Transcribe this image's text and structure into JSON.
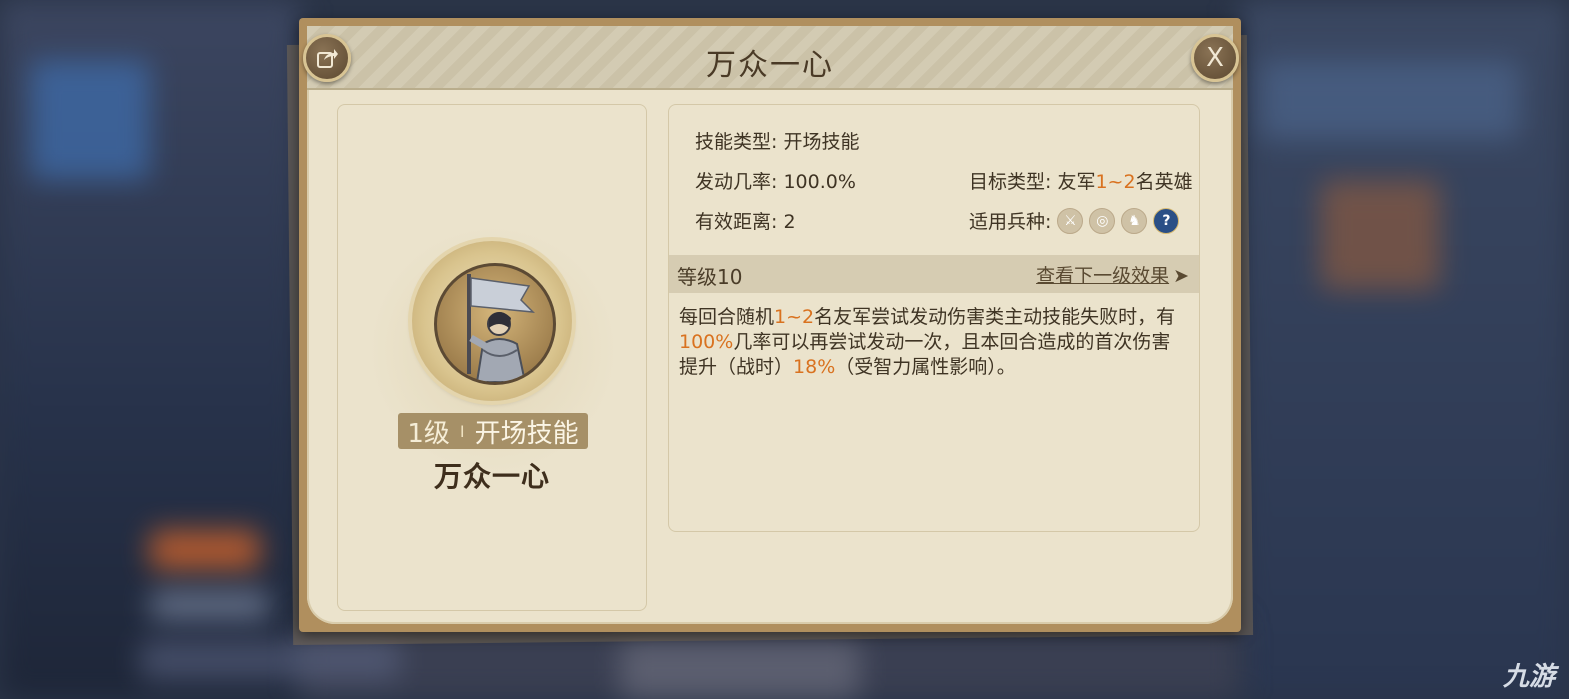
{
  "dialog": {
    "title": "万众一心",
    "share_icon": "share-icon",
    "close_label": "X"
  },
  "skill": {
    "level_badge": "1级",
    "separator": "I",
    "badge_type": "开场技能",
    "name": "万众一心"
  },
  "attributes": {
    "type_label": "技能类型: ",
    "type_value": "开场技能",
    "rate_label": "发动几率: ",
    "rate_value": "100.0%",
    "target_label": "目标类型: ",
    "target_prefix": "友军",
    "target_highlight": "1~2",
    "target_suffix": "名英雄",
    "range_label": "有效距离: ",
    "range_value": "2",
    "troops_label": "适用兵种: ",
    "troop_icons": [
      "sword-icon",
      "target-icon",
      "horse-icon",
      "question-icon"
    ]
  },
  "level": {
    "label": "等级10",
    "next_link": "查看下一级效果",
    "arrow": "➤"
  },
  "description": {
    "p1": "每回合随机",
    "h1": "1~2",
    "p2": "名友军尝试发动伤害类主动技能失败时，有",
    "h2": "100%",
    "p3": "几率可以再尝试发动一次，且本回合造成的首次伤害提升（战时）",
    "h3": "18%",
    "p4": "（受智力属性影响）。"
  },
  "watermark": "九游",
  "colors": {
    "highlight": "#d9721f",
    "frame": "#b08f5e",
    "parchment": "#ebe3cc"
  }
}
